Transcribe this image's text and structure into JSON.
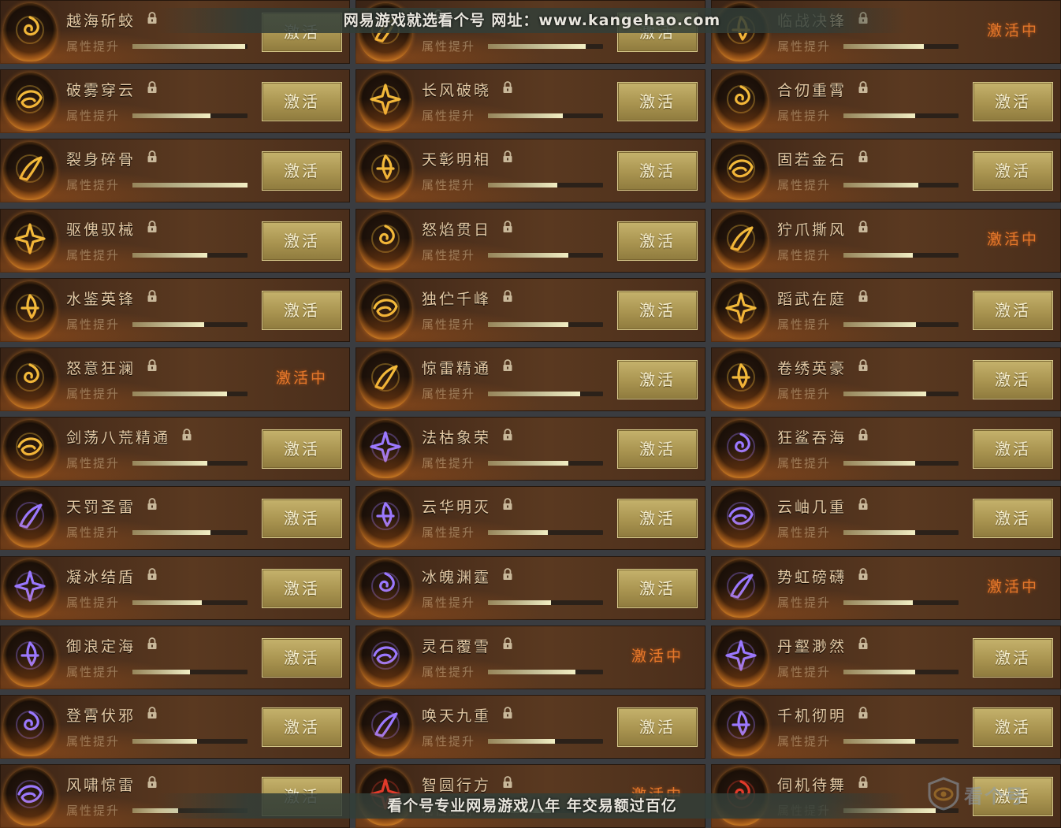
{
  "labels": {
    "attribute": "属性提升",
    "activate": "激活",
    "active": "激活中"
  },
  "colors": {
    "button_gold": "#b7a25a",
    "active_orange": "#e4772a",
    "name_text": "#e3c9a4",
    "gold_icon": "#f2b93a",
    "purple_icon": "#9a78ff",
    "red_icon": "#e23a2a"
  },
  "watermark": {
    "top": "网易游戏就选看个号  网址：www.kangehao.com",
    "bottom": "看个号专业网易游戏八年   年交易额过百亿"
  },
  "logo": {
    "text": "看个号",
    "icon": "eye-shield-icon"
  },
  "cards": [
    {
      "name": "越海斫蛟",
      "state": "activate",
      "progress": 0.98,
      "tone": "gold",
      "icon": "dragon-icon"
    },
    {
      "name": "",
      "state": "activate",
      "progress": 0.85,
      "tone": "gold",
      "icon": "flame-sword-icon"
    },
    {
      "name": "临战决锋",
      "state": "active",
      "progress": 0.7,
      "tone": "gold",
      "icon": "blade-icon"
    },
    {
      "name": "破雾穿云",
      "state": "activate",
      "progress": 0.68,
      "tone": "gold",
      "icon": "swirl-blade-icon"
    },
    {
      "name": "长风破晓",
      "state": "activate",
      "progress": 0.65,
      "tone": "gold",
      "icon": "feather-icon"
    },
    {
      "name": "合仞重霄",
      "state": "activate",
      "progress": 0.62,
      "tone": "gold",
      "icon": "crescent-icon"
    },
    {
      "name": "裂身碎骨",
      "state": "activate",
      "progress": 1.0,
      "tone": "gold",
      "icon": "shatter-icon"
    },
    {
      "name": "天彰明相",
      "state": "activate",
      "progress": 0.6,
      "tone": "gold",
      "icon": "radiance-icon"
    },
    {
      "name": "固若金石",
      "state": "activate",
      "progress": 0.65,
      "tone": "gold",
      "icon": "cloud-knot-icon"
    },
    {
      "name": "驱傀驭械",
      "state": "activate",
      "progress": 0.65,
      "tone": "gold",
      "icon": "puppet-icon"
    },
    {
      "name": "怒焰贯日",
      "state": "activate",
      "progress": 0.7,
      "tone": "gold",
      "icon": "fire-sun-icon"
    },
    {
      "name": "狞爪撕风",
      "state": "active",
      "progress": 0.6,
      "tone": "gold",
      "icon": "claw-icon"
    },
    {
      "name": "水鉴英锋",
      "state": "activate",
      "progress": 0.62,
      "tone": "gold",
      "icon": "water-mirror-icon"
    },
    {
      "name": "独伫千峰",
      "state": "activate",
      "progress": 0.7,
      "tone": "gold",
      "icon": "peak-icon"
    },
    {
      "name": "蹈武在庭",
      "state": "activate",
      "progress": 0.63,
      "tone": "gold",
      "icon": "spiral-icon"
    },
    {
      "name": "怒意狂澜",
      "state": "active",
      "progress": 0.82,
      "tone": "gold",
      "icon": "vortex-icon"
    },
    {
      "name": "惊雷精通",
      "state": "activate",
      "progress": 0.8,
      "tone": "gold",
      "icon": "thunder-icon"
    },
    {
      "name": "卷绣英豪",
      "state": "activate",
      "progress": 0.72,
      "tone": "gold",
      "icon": "scroll-icon"
    },
    {
      "name": "剑荡八荒精通",
      "state": "activate",
      "progress": 0.65,
      "tone": "gold",
      "icon": "sword-wave-icon"
    },
    {
      "name": "法枯象荣",
      "state": "activate",
      "progress": 0.7,
      "tone": "purple",
      "icon": "spirit-icon"
    },
    {
      "name": "狂鲨吞海",
      "state": "activate",
      "progress": 0.62,
      "tone": "purple",
      "icon": "shark-icon"
    },
    {
      "name": "天罚圣雷",
      "state": "activate",
      "progress": 0.68,
      "tone": "purple",
      "icon": "orbit-icon"
    },
    {
      "name": "云华明灭",
      "state": "activate",
      "progress": 0.52,
      "tone": "purple",
      "icon": "cloud-flame-icon"
    },
    {
      "name": "云岫几重",
      "state": "activate",
      "progress": 0.62,
      "tone": "purple",
      "icon": "mist-icon"
    },
    {
      "name": "凝冰结盾",
      "state": "activate",
      "progress": 0.6,
      "tone": "purple",
      "icon": "ice-shield-icon"
    },
    {
      "name": "冰魄渊霆",
      "state": "activate",
      "progress": 0.55,
      "tone": "purple",
      "icon": "ice-soul-icon"
    },
    {
      "name": "势虹磅礴",
      "state": "active",
      "progress": 0.6,
      "tone": "purple",
      "icon": "rainbow-icon"
    },
    {
      "name": "御浪定海",
      "state": "activate",
      "progress": 0.5,
      "tone": "purple",
      "icon": "wave-icon"
    },
    {
      "name": "灵石覆雪",
      "state": "active",
      "progress": 0.76,
      "tone": "purple",
      "icon": "snow-stone-icon"
    },
    {
      "name": "丹壑渺然",
      "state": "activate",
      "progress": 0.62,
      "tone": "purple",
      "icon": "valley-icon"
    },
    {
      "name": "登霄伏邪",
      "state": "activate",
      "progress": 0.56,
      "tone": "purple",
      "icon": "ascend-icon"
    },
    {
      "name": "唤天九重",
      "state": "activate",
      "progress": 0.58,
      "tone": "purple",
      "icon": "trident-icon"
    },
    {
      "name": "千机彻明",
      "state": "activate",
      "progress": 0.62,
      "tone": "purple",
      "icon": "galaxy-icon"
    },
    {
      "name": "风啸惊雷",
      "state": "activate",
      "progress": 0.4,
      "tone": "purple",
      "icon": "storm-icon"
    },
    {
      "name": "智圆行方",
      "state": "active",
      "progress": 0.55,
      "tone": "red",
      "icon": "crimson-icon"
    },
    {
      "name": "伺机待舞",
      "state": "activate",
      "progress": 0.8,
      "tone": "red",
      "icon": "dance-icon"
    }
  ]
}
